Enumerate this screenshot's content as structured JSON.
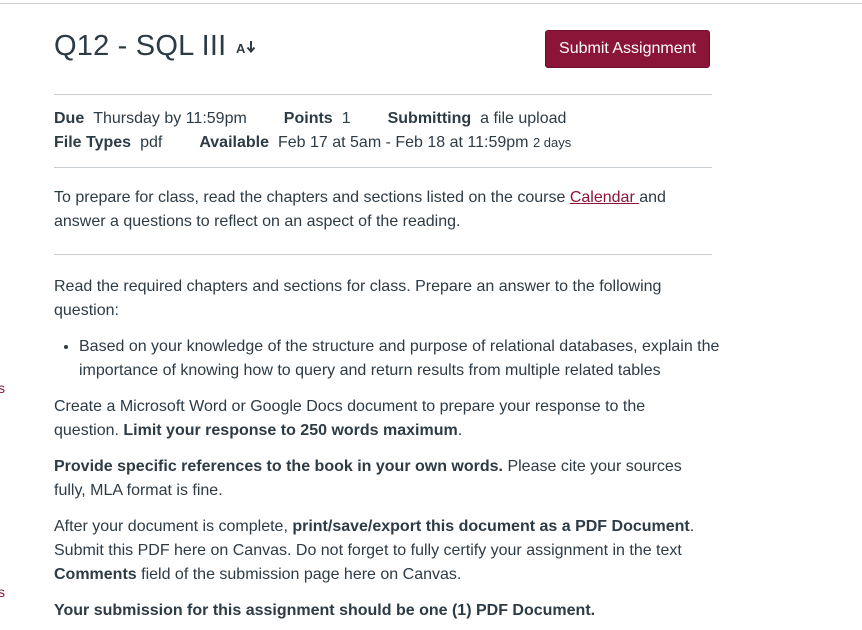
{
  "assignment": {
    "title": "Q12 - SQL III",
    "submit_label": "Submit Assignment",
    "due_label": "Due",
    "due_value": "Thursday by 11:59pm",
    "points_label": "Points",
    "points_value": "1",
    "submitting_label": "Submitting",
    "submitting_value": "a file upload",
    "file_types_label": "File Types",
    "file_types_value": "pdf",
    "available_label": "Available",
    "available_value": "Feb 17 at 5am - Feb 18 at 11:59pm",
    "available_duration": "2 days"
  },
  "intro": {
    "before_link": "To prepare for class, read the chapters and sections listed on the course ",
    "link_text": "Calendar ",
    "after_link": "and answer a questions to reflect on an aspect of the reading."
  },
  "body": {
    "p1": "Read the required chapters and sections for class. Prepare an answer to the following question:",
    "bullet1": "Based on your knowledge of the structure and purpose of relational databases, explain the importance of knowing how to query and return results from multiple related tables",
    "p2_text": "Create a Microsoft Word or Google Docs document to prepare your response to the question. ",
    "p2_bold": "Limit your response to 250 words maximum",
    "p2_end": ".",
    "p3_bold": "Provide specific references to the book in your own words.",
    "p3_text": " Please cite your sources fully, MLA format is fine.",
    "p4_text1": "After your document is complete, ",
    "p4_bold1": "print/save/export this document as a PDF Document",
    "p4_text2": ". Submit this PDF here on Canvas. Do not forget to fully certify your assignment in the text ",
    "p4_bold2": "Comments",
    "p4_text3": " field of the submission page here on Canvas.",
    "p5_bold": "Your submission for this assignment should be one (1) PDF Document."
  },
  "left_edge": {
    "glyph1": "s",
    "glyph2": "s"
  },
  "icons": {
    "title_icon": "sort-az-icon"
  },
  "colors": {
    "accent": "#8b1538",
    "text": "#2d3b45",
    "divider": "#c7cdd1"
  }
}
